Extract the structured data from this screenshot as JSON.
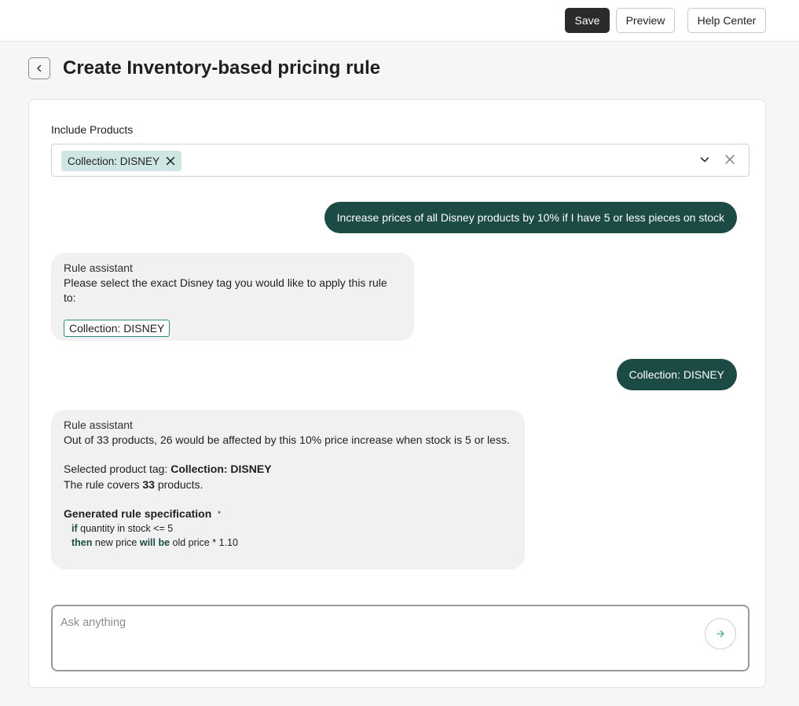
{
  "toolbar": {
    "save_label": "Save",
    "preview_label": "Preview",
    "help_label": "Help Center"
  },
  "page": {
    "title": "Create Inventory-based pricing rule"
  },
  "include": {
    "label": "Include Products",
    "selected_chip": "Collection: DISNEY"
  },
  "chat": {
    "user_message_1": "Increase prices of all Disney products by 10% if I have 5 or less pieces on stock",
    "assistant_1": {
      "name": "Rule assistant",
      "text": "Please select the exact Disney tag you would like to apply this rule to:",
      "option": "Collection: DISNEY"
    },
    "user_message_2": "Collection: DISNEY",
    "assistant_2": {
      "name": "Rule assistant",
      "summary": "Out of 33 products, 26 would be affected by this 10% price increase when stock is 5 or less.",
      "selected_tag_prefix": "Selected product tag: ",
      "selected_tag": "Collection: DISNEY",
      "covers_prefix": "The rule covers ",
      "covers_count": "33",
      "covers_suffix": " products.",
      "spec_title": "Generated rule specification",
      "spec_star": "*",
      "spec_if_kw": "if",
      "spec_if_rest": " quantity in stock <= 5",
      "spec_then_kw": "then",
      "spec_then_mid": " new price ",
      "spec_will_be_kw": "will be",
      "spec_then_rest": " old price * 1.10"
    }
  },
  "composer": {
    "placeholder": "Ask anything"
  },
  "colors": {
    "accent_dark_teal": "#1c4b45",
    "chip_bg": "#cfe7e4",
    "option_border": "#2e8c80"
  },
  "icons": {
    "back": "chevron-left-icon",
    "chip_remove": "close-icon",
    "select_open": "chevron-down-icon",
    "select_clear": "close-icon",
    "send": "arrow-right-icon"
  }
}
